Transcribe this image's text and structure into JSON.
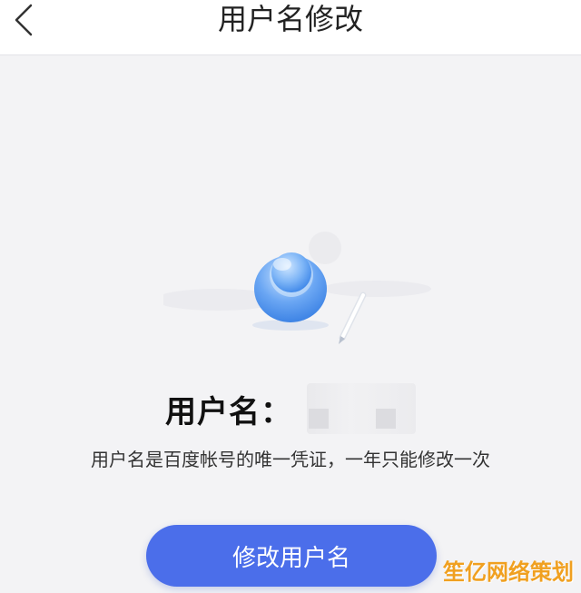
{
  "nav": {
    "title": "用户名修改",
    "back_icon": "chevron-left-icon"
  },
  "profile": {
    "label": "用户名：",
    "username_value": "",
    "description": "用户名是百度帐号的唯一凭证，一年只能修改一次"
  },
  "actions": {
    "modify_label": "修改用户名"
  },
  "watermark": "笙亿网络策划",
  "colors": {
    "accent": "#4b6eea",
    "background": "#f3f3f5",
    "watermark": "#f0a020"
  }
}
